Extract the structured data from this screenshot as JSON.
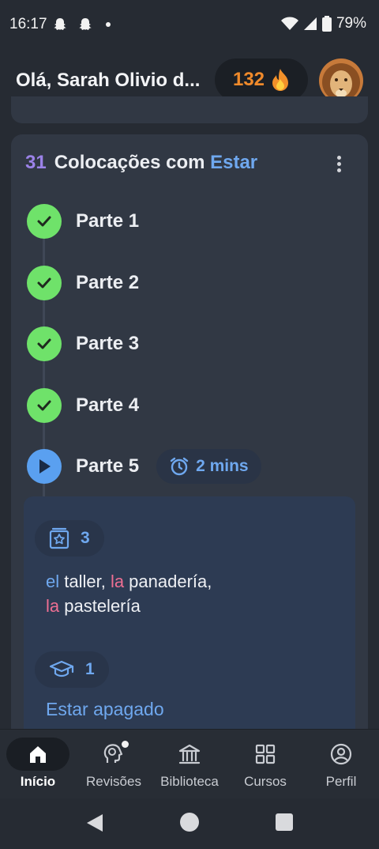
{
  "status": {
    "time": "16:17",
    "battery": "79%"
  },
  "header": {
    "greeting": "Olá, Sarah Olivio d...",
    "streak": "132"
  },
  "unit": {
    "number": "31",
    "title": "Colocações com",
    "accent": "Estar",
    "parts": [
      {
        "label": "Parte 1",
        "state": "done"
      },
      {
        "label": "Parte 2",
        "state": "done"
      },
      {
        "label": "Parte 3",
        "state": "done"
      },
      {
        "label": "Parte 4",
        "state": "done"
      },
      {
        "label": "Parte 5",
        "state": "current"
      }
    ],
    "duration": "2 mins"
  },
  "lesson": {
    "words_count": "3",
    "line1": {
      "art1": "el",
      "w1": " taller, ",
      "art2": "la",
      "w2": " panadería,"
    },
    "line2": {
      "art3": "la",
      "w3": " pastelería"
    },
    "grammar_count": "1",
    "grammar_link": "Estar apagado"
  },
  "nav": {
    "items": [
      {
        "label": "Início",
        "icon": "home-icon",
        "active": true
      },
      {
        "label": "Revisões",
        "icon": "head-icon",
        "active": false
      },
      {
        "label": "Biblioteca",
        "icon": "library-icon",
        "active": false
      },
      {
        "label": "Cursos",
        "icon": "grid-icon",
        "active": false
      },
      {
        "label": "Perfil",
        "icon": "profile-icon",
        "active": false
      }
    ]
  },
  "colors": {
    "accent": "#6fa8ef",
    "done": "#6fe26a",
    "streak": "#f08a2b",
    "feminine": "#ee6f93"
  }
}
